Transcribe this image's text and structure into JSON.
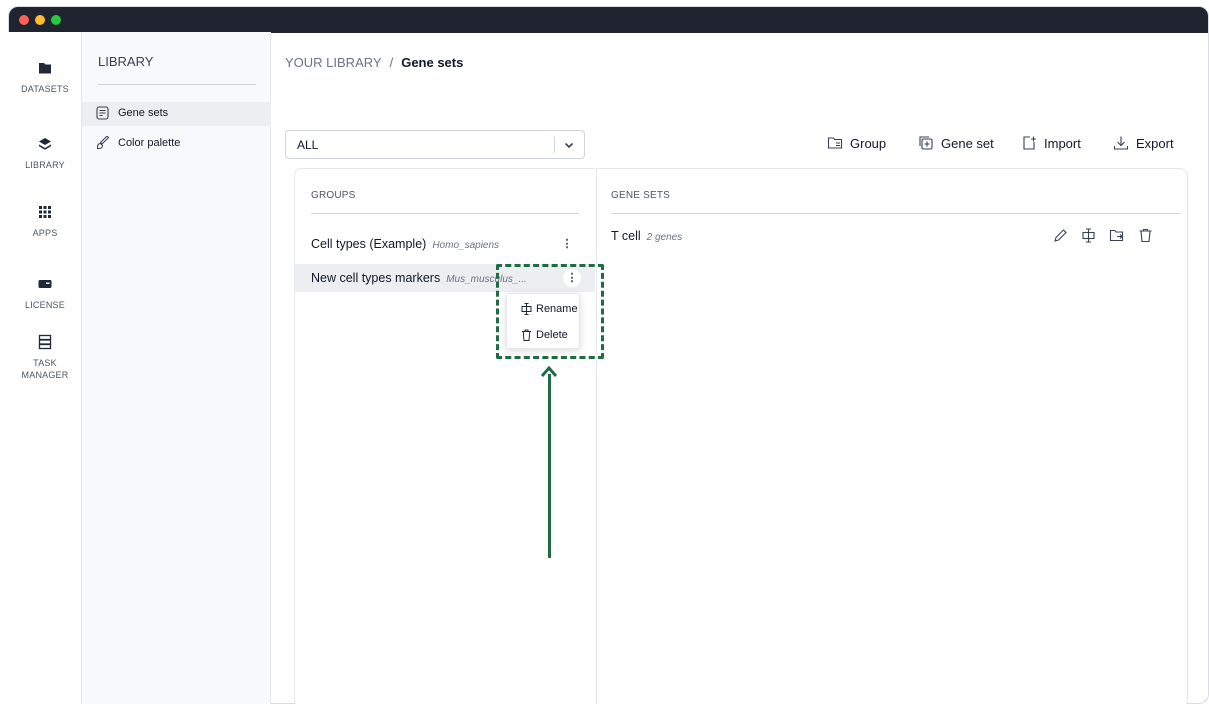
{
  "rail": {
    "items": [
      {
        "label": "DATASETS",
        "icon": "folder-icon"
      },
      {
        "label": "LIBRARY",
        "icon": "layers-icon"
      },
      {
        "label": "APPS",
        "icon": "apps-grid-icon"
      },
      {
        "label": "LICENSE",
        "icon": "license-icon"
      },
      {
        "label": "TASK MANAGER",
        "icon": "task-manager-icon"
      }
    ]
  },
  "sidebar": {
    "title": "LIBRARY",
    "items": [
      {
        "label": "Gene sets",
        "icon": "gene-sets-icon",
        "active": true
      },
      {
        "label": "Color palette",
        "icon": "brush-icon",
        "active": false
      }
    ]
  },
  "breadcrumb": {
    "root": "YOUR LIBRARY",
    "separator": "/",
    "current": "Gene sets"
  },
  "filter": {
    "value": "ALL"
  },
  "toolbar": {
    "group_label": "Group",
    "gene_set_label": "Gene set",
    "import_label": "Import",
    "export_label": "Export"
  },
  "groups": {
    "title": "GROUPS",
    "rows": [
      {
        "name": "Cell types (Example)",
        "meta": "Homo_sapiens",
        "selected": false
      },
      {
        "name": "New cell types markers",
        "meta": "Mus_musculus_...",
        "selected": true
      }
    ]
  },
  "context_menu": {
    "items": [
      {
        "label": "Rename",
        "icon": "rename-icon"
      },
      {
        "label": "Delete",
        "icon": "trash-icon"
      }
    ]
  },
  "gene_sets": {
    "title": "GENE SETS",
    "rows": [
      {
        "name": "T cell",
        "meta": "2 genes"
      }
    ]
  },
  "colors": {
    "highlight": "#1f6b44",
    "titlebar": "#1f2430",
    "selected_row": "#eceef2"
  }
}
